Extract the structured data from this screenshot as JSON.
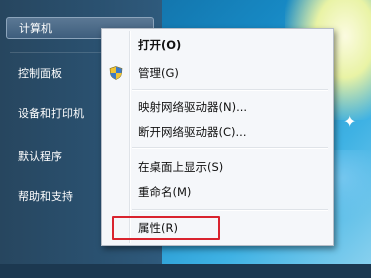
{
  "start_menu": {
    "items": [
      {
        "label": "计算机"
      },
      {
        "label": "控制面板"
      },
      {
        "label": "设备和打印机"
      },
      {
        "label": "默认程序"
      },
      {
        "label": "帮助和支持"
      }
    ]
  },
  "context_menu": {
    "items": [
      {
        "label": "打开(O)",
        "bold": true
      },
      {
        "label": "管理(G)",
        "icon": "shield-icon"
      },
      {
        "label": "映射网络驱动器(N)..."
      },
      {
        "label": "断开网络驱动器(C)..."
      },
      {
        "label": "在桌面上显示(S)"
      },
      {
        "label": "重命名(M)"
      },
      {
        "label": "属性(R)"
      }
    ],
    "highlight_color": "#d9232e"
  },
  "desktop": {
    "accent": "#1789c4"
  }
}
